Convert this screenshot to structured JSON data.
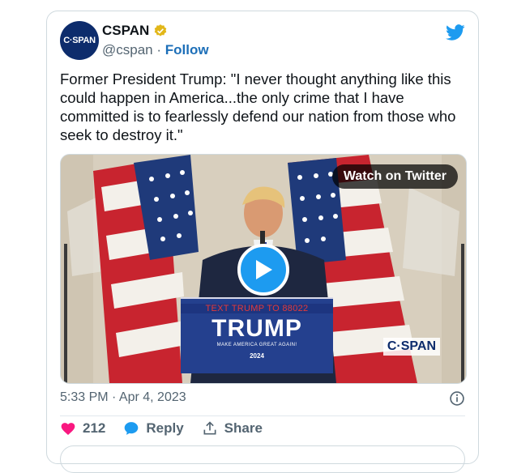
{
  "account": {
    "avatar_text": "C·SPAN",
    "name": "CSPAN",
    "handle": "@cspan",
    "separator": "·",
    "follow_label": "Follow"
  },
  "tweet": {
    "text": "Former President Trump: \"I never thought anything like this could happen in America...the only crime that I have committed is to fearlessly defend our nation from those who seek to destroy it.\""
  },
  "media": {
    "watch_label": "Watch on Twitter",
    "podium_line1": "TEXT TRUMP TO 88022",
    "podium_line2": "TRUMP",
    "podium_line3": "MAKE AMERICA GREAT AGAIN!",
    "podium_line4": "2024",
    "watermark": "C·SPAN"
  },
  "meta": {
    "timestamp": "5:33 PM · Apr 4, 2023"
  },
  "actions": {
    "like_count": "212",
    "reply_label": "Reply",
    "share_label": "Share"
  },
  "colors": {
    "accent": "#1d9bf0",
    "like": "#f91880",
    "text": "#0f1419",
    "muted": "#536471"
  }
}
